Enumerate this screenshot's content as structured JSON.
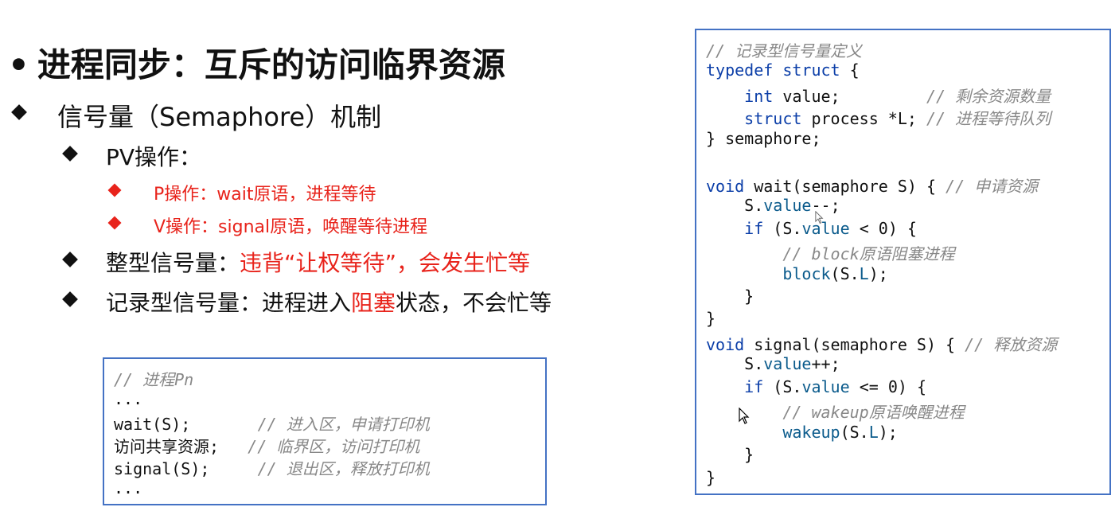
{
  "heading": {
    "bullet": "•",
    "text": "进程同步：互斥的访问临界资源"
  },
  "outline": {
    "semaphore": "信号量（Semaphore）机制",
    "pv": "PV操作：",
    "p_op": "P操作：wait原语，进程等待",
    "v_op": "V操作：signal原语，唤醒等待进程",
    "integer_prefix": "整型信号量：",
    "integer_red": "违背“让权等待”，会发生忙等",
    "record_prefix": "记录型信号量：进程进入",
    "record_red": "阻塞",
    "record_suffix": "状态，不会忙等"
  },
  "process_code": {
    "lines": [
      {
        "code": "",
        "comment": "// 进程Pn"
      },
      {
        "code": "...",
        "comment": ""
      },
      {
        "code": "wait(S);       ",
        "comment": "// 进入区，申请打印机"
      },
      {
        "code": "访问共享资源;   ",
        "comment": "// 临界区，访问打印机"
      },
      {
        "code": "signal(S);     ",
        "comment": "// 退出区，释放打印机"
      },
      {
        "code": "...",
        "comment": ""
      }
    ]
  },
  "semaphore_code": {
    "l01_comment": "// 记录型信号量定义",
    "l02_kw": "typedef struct",
    "l02_rest": " {",
    "l03_kw": "int",
    "l03_rest": " value;         ",
    "l03_comment": "// 剩余资源数量",
    "l04_kw": "struct",
    "l04_rest": " process *L; ",
    "l04_comment": "// 进程等待队列",
    "l05": "} semaphore;",
    "l07_kw": "void",
    "l07_rest": " wait(semaphore S) { ",
    "l07_comment": "// 申请资源",
    "l08_pre": "S.",
    "l08_field": "value",
    "l08_post": "--;",
    "l09_kw": "if",
    "l09_pre": " (S.",
    "l09_field": "value",
    "l09_post": " < 0) {",
    "l10_comment": "// block原语阻塞进程",
    "l11_fn": "block",
    "l11_pre": "(S.",
    "l11_field": "L",
    "l11_post": ");",
    "l12": "}",
    "l13": "}",
    "l14_kw": "void",
    "l14_rest": " signal(semaphore S) { ",
    "l14_comment": "// 释放资源",
    "l15_pre": "S.",
    "l15_field": "value",
    "l15_post": "++;",
    "l16_kw": "if",
    "l16_pre": " (S.",
    "l16_field": "value",
    "l16_post": " <= 0) {",
    "l17_comment": "// wakeup原语唤醒进程",
    "l18_fn": "wakeup",
    "l18_pre": "(S.",
    "l18_field": "L",
    "l18_post": ");",
    "l19": "}",
    "l20": "}"
  },
  "colors": {
    "accent_red": "#e8231b",
    "box_border": "#4472c4",
    "keyword_blue": "#0b3ea8",
    "comment_gray": "#888888"
  },
  "icons": [
    "mouse-pointer-icon",
    "diamond-bullet-icon"
  ]
}
